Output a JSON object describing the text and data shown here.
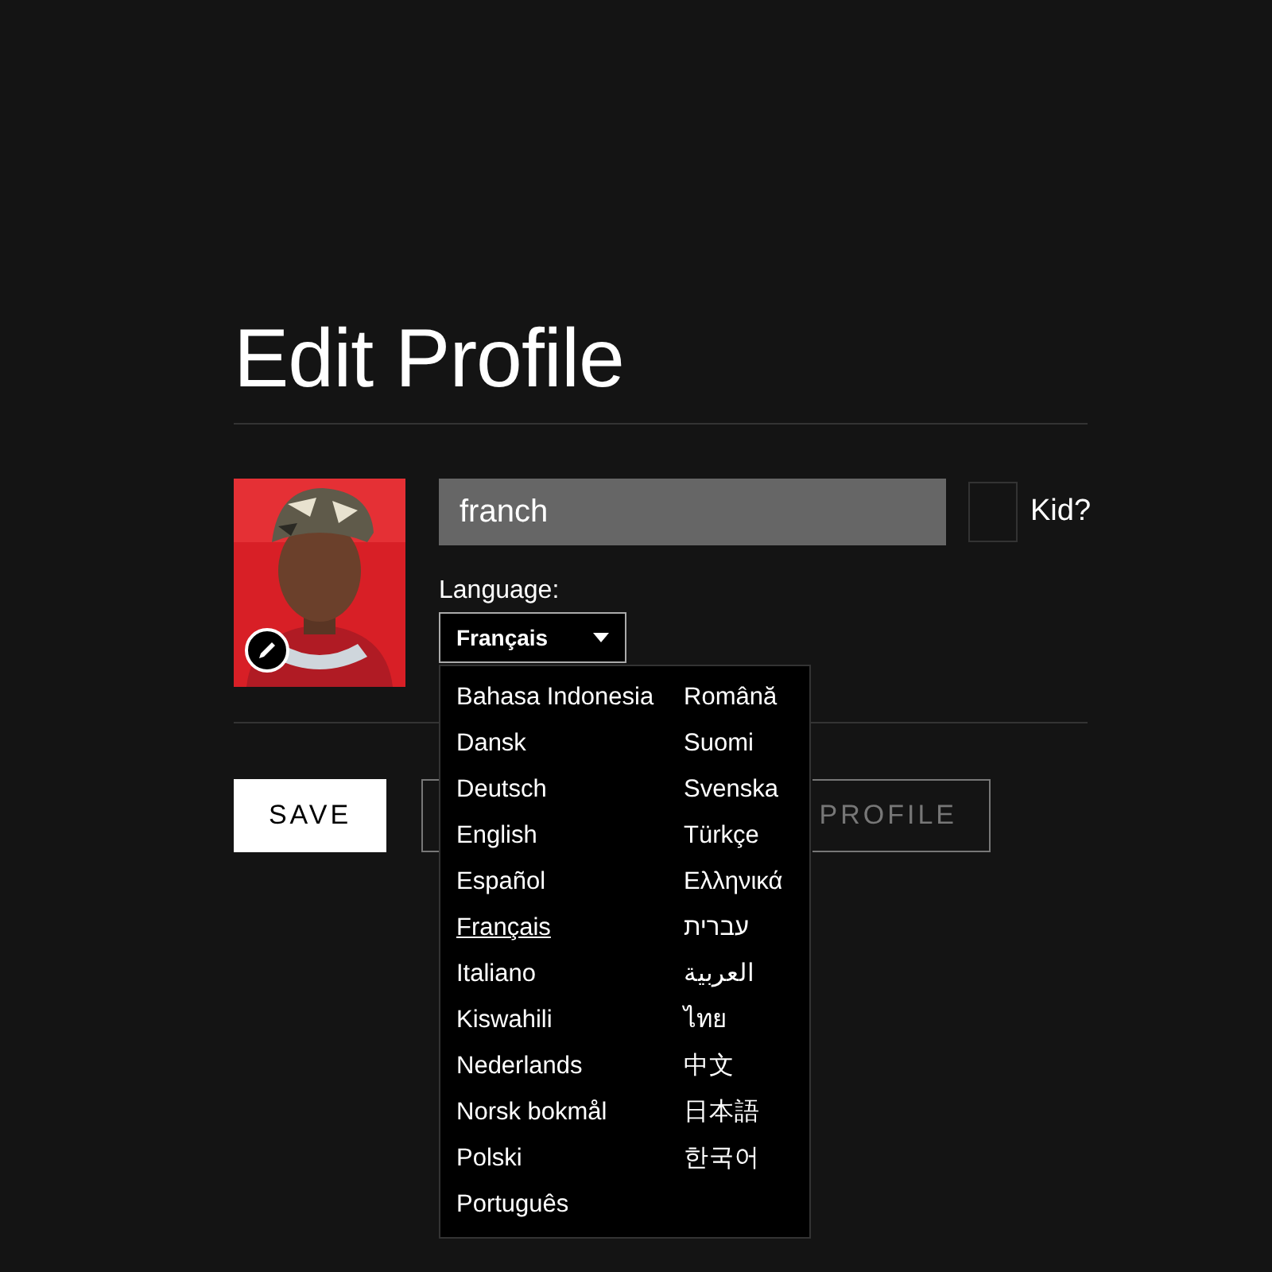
{
  "title": "Edit Profile",
  "profile": {
    "name": "franch",
    "kid": {
      "label": "Kid?",
      "checked": false
    }
  },
  "language": {
    "label": "Language:",
    "value": "Français",
    "expanded": true,
    "options": [
      {
        "label": "Bahasa Indonesia",
        "selected": false
      },
      {
        "label": "Dansk",
        "selected": false
      },
      {
        "label": "Deutsch",
        "selected": false
      },
      {
        "label": "English",
        "selected": false
      },
      {
        "label": "Español",
        "selected": false
      },
      {
        "label": "Français",
        "selected": true
      },
      {
        "label": "Italiano",
        "selected": false
      },
      {
        "label": "Kiswahili",
        "selected": false
      },
      {
        "label": "Nederlands",
        "selected": false
      },
      {
        "label": "Norsk bokmål",
        "selected": false
      },
      {
        "label": "Polski",
        "selected": false
      },
      {
        "label": "Português",
        "selected": false
      },
      {
        "label": "Română",
        "selected": false
      },
      {
        "label": "Suomi",
        "selected": false
      },
      {
        "label": "Svenska",
        "selected": false
      },
      {
        "label": "Türkçe",
        "selected": false
      },
      {
        "label": "Ελληνικά",
        "selected": false
      },
      {
        "label": "עברית",
        "selected": false
      },
      {
        "label": "العربية",
        "selected": false
      },
      {
        "label": "ไทย",
        "selected": false
      },
      {
        "label": "中文",
        "selected": false
      },
      {
        "label": "日本語",
        "selected": false
      },
      {
        "label": "한국어",
        "selected": false
      }
    ]
  },
  "buttons": [
    {
      "label": "SAVE",
      "kind": "primary"
    },
    {
      "kind": "secondary"
    },
    {
      "label": "PROFILE",
      "kind": "secondary"
    }
  ]
}
